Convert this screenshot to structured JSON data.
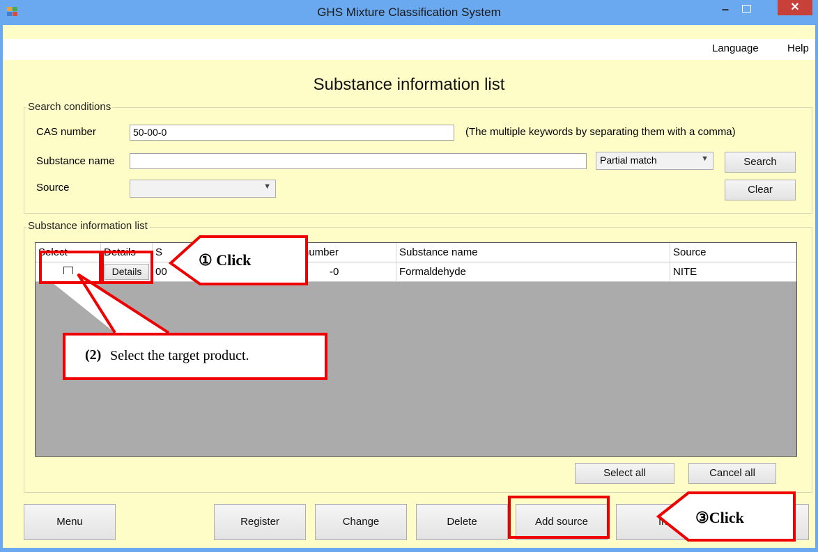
{
  "window": {
    "title": "GHS Mixture Classification System",
    "minimize_glyph": "–",
    "close_glyph": "✕"
  },
  "menubar": {
    "items": [
      {
        "label": "Language"
      },
      {
        "label": "Help"
      }
    ]
  },
  "page": {
    "title": "Substance information list"
  },
  "search": {
    "group_label": "Search conditions",
    "cas_label": "CAS number",
    "cas_value": "50-00-0",
    "cas_hint": "(The multiple keywords by separating them with a comma)",
    "name_label": "Substance name",
    "name_value": "",
    "match_mode": "Partial match",
    "source_label": "Source",
    "source_value": "",
    "search_button": "Search",
    "clear_button": "Clear"
  },
  "list": {
    "group_label": "Substance information list",
    "columns": [
      "Select",
      "Details",
      "S",
      "number",
      "Substance name",
      "Source"
    ],
    "rows": [
      {
        "details_button": "Details",
        "id_partial": "00",
        "cas_partial": "-0",
        "substance_name": "Formaldehyde",
        "source": "NITE"
      }
    ],
    "select_all_button": "Select all",
    "cancel_all_button": "Cancel all"
  },
  "bottom_buttons": {
    "menu": "Menu",
    "register": "Register",
    "change": "Change",
    "delete": "Delete",
    "add_source": "Add source",
    "import_partial": "In"
  },
  "annotations": {
    "step1": "①  Click",
    "step2_num": "(2)",
    "step2_text": "Select the target product.",
    "step3": "③Click",
    "color": "#ee0000"
  }
}
